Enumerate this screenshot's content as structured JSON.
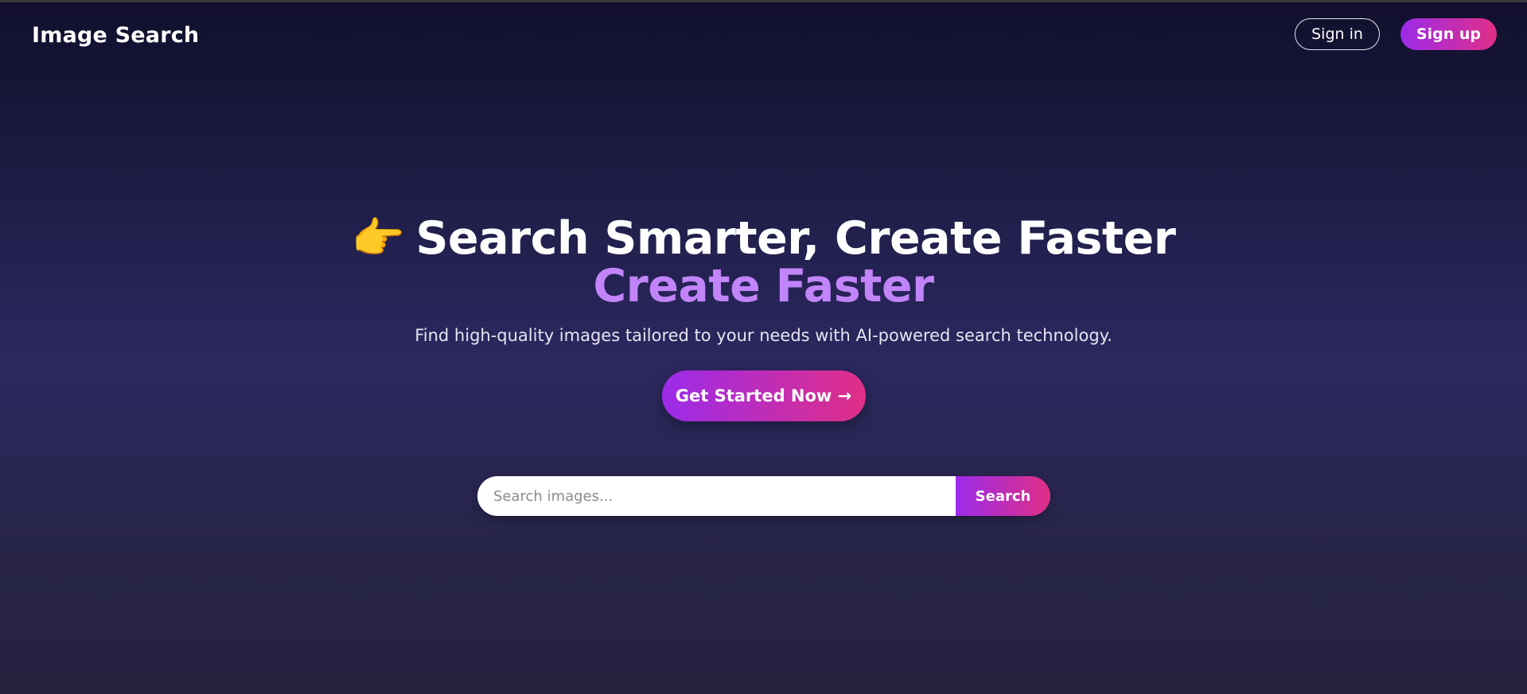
{
  "nav": {
    "brand": "Image Search",
    "sign_in_label": "Sign in",
    "sign_up_label": "Sign up"
  },
  "hero": {
    "emoji": "👉",
    "headline": "Search Smarter, Create Faster",
    "headline_accent": "Create Faster",
    "subtitle": "Find high-quality images tailored to your needs with AI-powered search technology.",
    "cta_label": "Get Started Now →"
  },
  "search": {
    "placeholder": "Search images...",
    "value": "",
    "button_label": "Search"
  },
  "colors": {
    "accent_start": "#9b2bea",
    "accent_end": "#e02f86",
    "headline_accent": "#c184f9"
  }
}
